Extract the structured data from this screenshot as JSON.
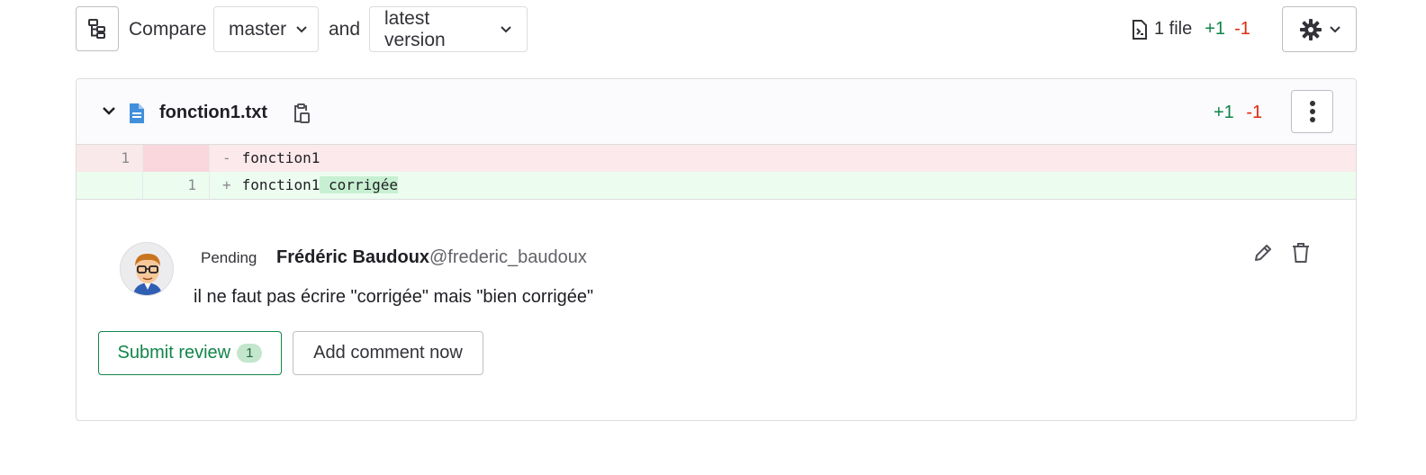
{
  "compare_bar": {
    "compare_label": "Compare",
    "source_branch": "master",
    "and_label": "and",
    "target_version": "latest version",
    "file_count": "1 file",
    "additions": "+1",
    "deletions": "-1"
  },
  "file": {
    "name": "fonction1.txt",
    "additions": "+1",
    "deletions": "-1"
  },
  "diff": {
    "removed_line": {
      "old_number": "1",
      "new_number": "",
      "sign": "-",
      "text": "fonction1"
    },
    "added_line": {
      "old_number": "",
      "new_number": "1",
      "sign": "+",
      "text_unchanged": "fonction1",
      "text_added": " corrigée"
    }
  },
  "comment": {
    "status": "Pending",
    "author_name": "Frédéric Baudoux",
    "author_username": "@frederic_baudoux",
    "body": "il ne faut pas écrire \"corrigée\" mais \"bien corrigée\""
  },
  "actions": {
    "submit_label": "Submit review",
    "submit_count": "1",
    "add_comment_label": "Add comment now"
  },
  "colors": {
    "addition": "#108548",
    "deletion": "#dd2b0e",
    "removed_bg": "#fbe9eb",
    "added_bg": "#ecfdf0",
    "added_highlight": "#c7f0d2"
  }
}
